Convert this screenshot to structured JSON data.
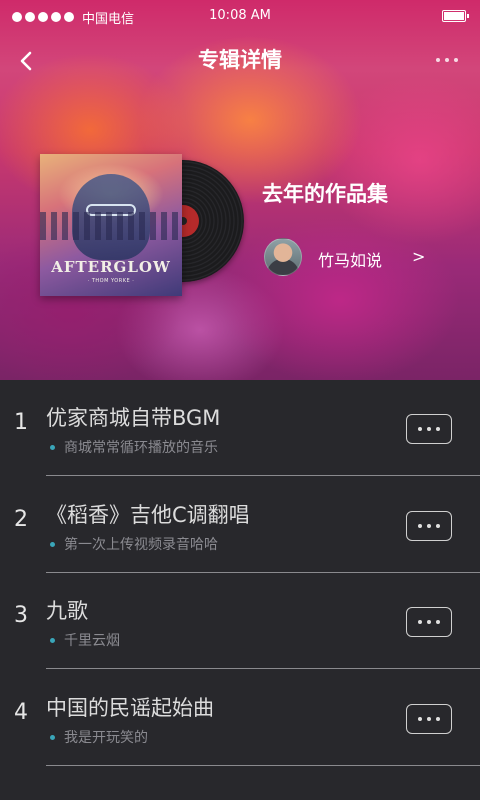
{
  "status_bar": {
    "carrier": "中国电信",
    "time": "10:08 AM"
  },
  "nav": {
    "title": "专辑详情",
    "back_icon": "chevron-left-icon",
    "more_icon": "more-dots-icon"
  },
  "album": {
    "title": "去年的作品集",
    "cover_art_title": "AFTERGLOW",
    "cover_art_subtitle": "· THOM YORKE ·",
    "artist": {
      "name": "竹马如说",
      "chevron": ">"
    }
  },
  "songs": [
    {
      "number": "1",
      "title": "优家商城自带BGM",
      "subtitle": "商城常常循环播放的音乐"
    },
    {
      "number": "2",
      "title": "《稻香》吉他C调翻唱",
      "subtitle": "第一次上传视频录音哈哈"
    },
    {
      "number": "3",
      "title": "九歌",
      "subtitle": "千里云烟"
    },
    {
      "number": "4",
      "title": "中国的民谣起始曲",
      "subtitle": "我是开玩笑的"
    }
  ],
  "colors": {
    "accent_dot": "#3aa6b9",
    "list_background": "#28282c"
  }
}
